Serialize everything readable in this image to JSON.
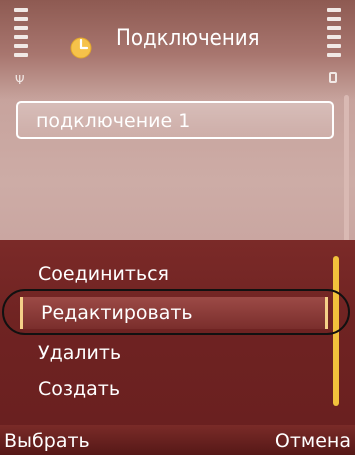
{
  "header": {
    "title": "Подключения",
    "left_icon": "signal-strength-icon",
    "right_icon": "battery-level-icon",
    "app_icon": "clock-icon",
    "signal_bars": 6,
    "battery_bars": 6
  },
  "list": {
    "items": [
      {
        "label": "подключение 1"
      }
    ]
  },
  "menu": {
    "items": [
      {
        "label": "Соединиться"
      },
      {
        "label": "Редактировать",
        "selected": true
      },
      {
        "label": "Удалить"
      },
      {
        "label": "Создать"
      }
    ]
  },
  "softkeys": {
    "left_label": "Выбрать",
    "right_label": "Отмена"
  },
  "colors": {
    "menu_background": "#6f2322",
    "selection_border": "#f5d089",
    "scrollbar_thumb": "#f2c13c"
  }
}
